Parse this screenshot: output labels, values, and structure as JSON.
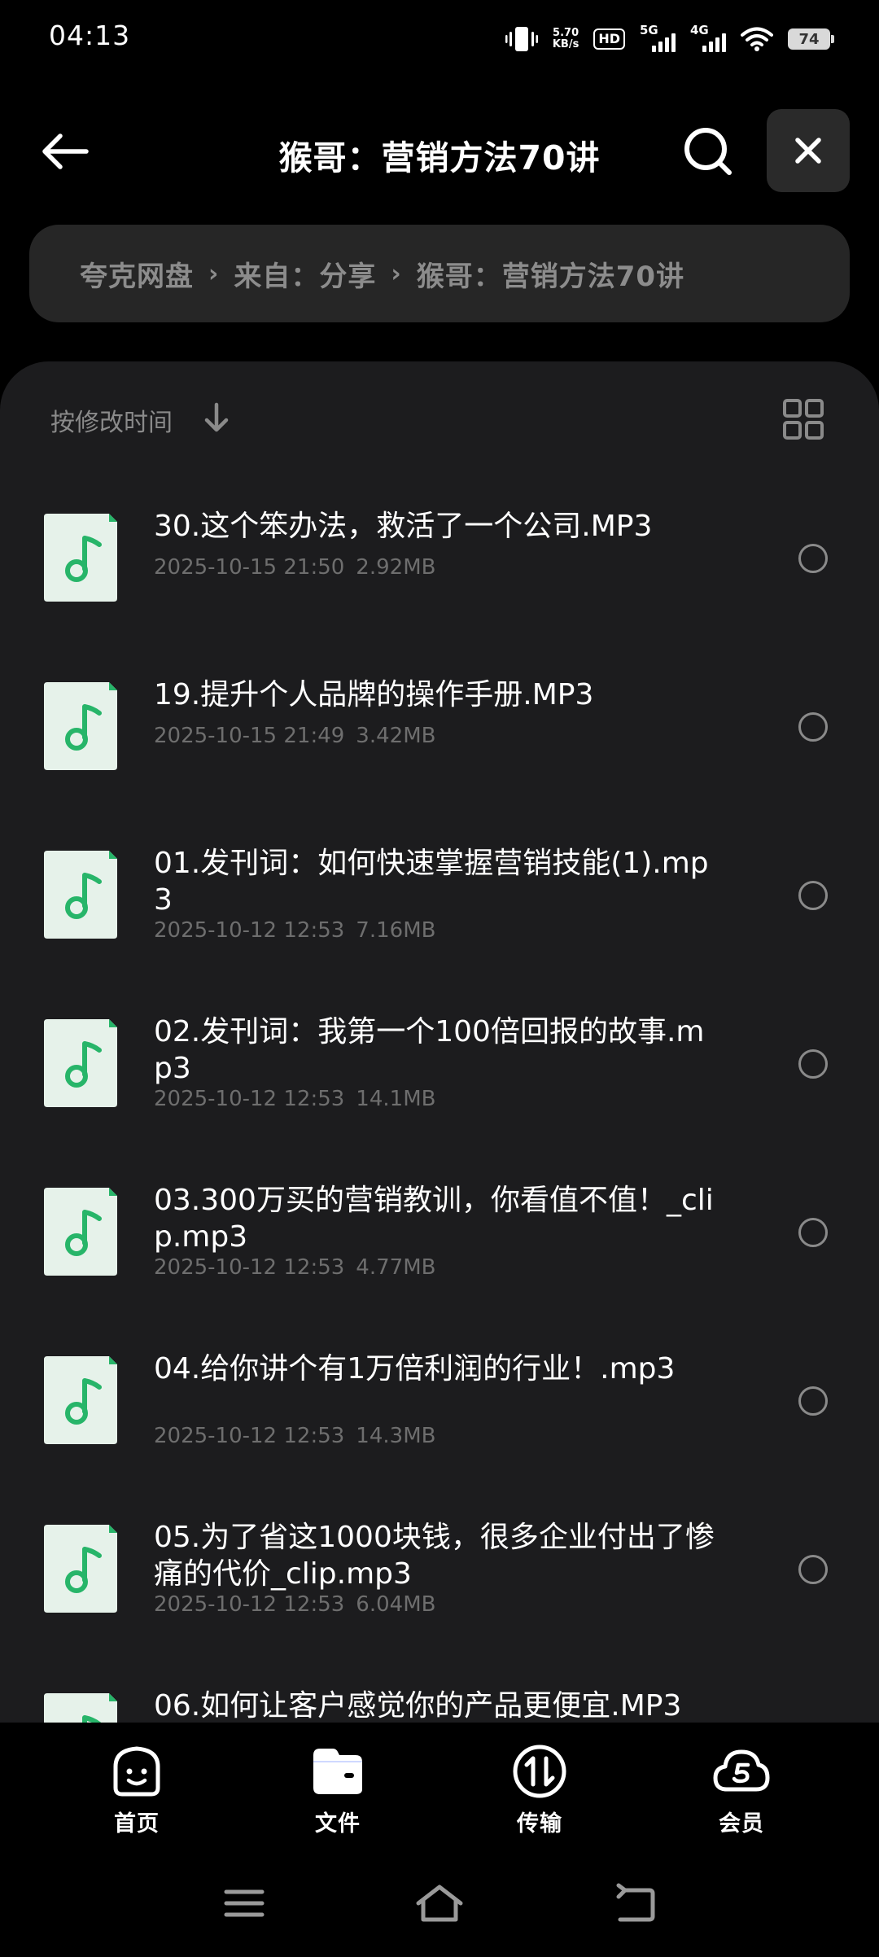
{
  "status_bar": {
    "time": "04:13",
    "net_speed_value": "5.70",
    "net_speed_unit": "KB/s",
    "hd_label": "HD",
    "sim1_label": "5G",
    "sim2_label": "4G",
    "battery": "74"
  },
  "header": {
    "title": "猴哥：营销方法70讲"
  },
  "breadcrumb": {
    "items": [
      "夸克网盘",
      "来自：分享",
      "猴哥：营销方法70讲"
    ],
    "separator": "›"
  },
  "sort": {
    "label": "按修改时间"
  },
  "files": [
    {
      "name": "30.这个笨办法，救活了一个公司.MP3",
      "date": "2025-10-15 21:50",
      "size": "2.92MB"
    },
    {
      "name": "19.提升个人品牌的操作手册.MP3",
      "date": "2025-10-15 21:49",
      "size": "3.42MB"
    },
    {
      "name": "01.发刊词：如何快速掌握营销技能(1).mp3",
      "date": "2025-10-12 12:53",
      "size": "7.16MB"
    },
    {
      "name": "02.发刊词：我第一个100倍回报的故事.mp3",
      "date": "2025-10-12 12:53",
      "size": "14.1MB"
    },
    {
      "name": "03.300万买的营销教训，你看值不值！_clip.mp3",
      "date": "2025-10-12 12:53",
      "size": "4.77MB"
    },
    {
      "name": "04.给你讲个有1万倍利润的行业！.mp3",
      "date": "2025-10-12 12:53",
      "size": "14.3MB"
    },
    {
      "name": "05.为了省这1000块钱，很多企业付出了惨痛的代价_clip.mp3",
      "date": "2025-10-12 12:53",
      "size": "6.04MB"
    },
    {
      "name": "06.如何让客户感觉你的产品更便宜.MP3",
      "date": "",
      "size": ""
    }
  ],
  "bottom_nav": [
    {
      "label": "首页",
      "icon": "home-face-icon"
    },
    {
      "label": "文件",
      "icon": "folder-icon"
    },
    {
      "label": "传输",
      "icon": "transfer-icon"
    },
    {
      "label": "会员",
      "icon": "cloud-vip-icon"
    }
  ],
  "colors": {
    "background": "#000000",
    "panel": "#1c1c1e",
    "breadcrumb_bg": "#262626",
    "file_icon_bg": "#e6f2ea",
    "file_icon_accent": "#27b569",
    "muted_text": "#6e6e6e"
  }
}
